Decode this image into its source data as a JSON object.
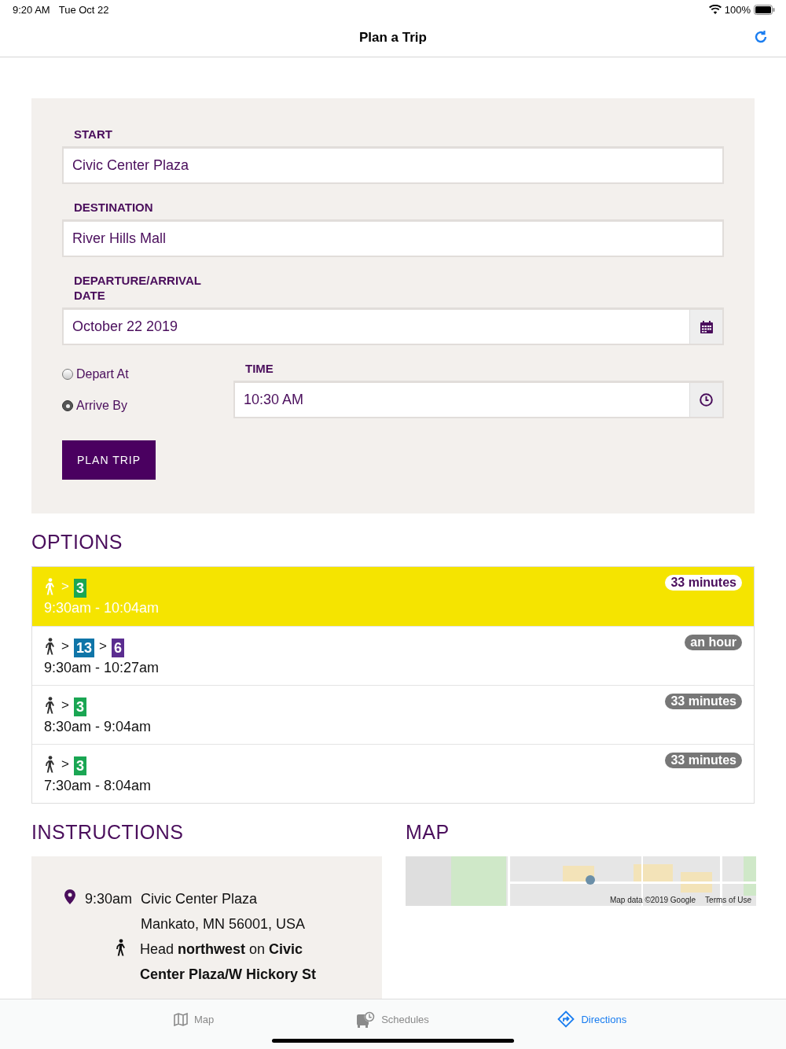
{
  "status_bar": {
    "time": "9:20 AM",
    "date": "Tue Oct 22",
    "battery": "100%"
  },
  "nav": {
    "title": "Plan a Trip"
  },
  "form": {
    "start": {
      "label": "START",
      "value": "Civic Center Plaza"
    },
    "destination": {
      "label": "DESTINATION",
      "value": "River Hills Mall"
    },
    "date": {
      "label": "DEPARTURE/ARRIVAL DATE",
      "value": "October 22 2019"
    },
    "modes": [
      {
        "label": "Depart At",
        "selected": false
      },
      {
        "label": "Arrive By",
        "selected": true
      }
    ],
    "time": {
      "label": "TIME",
      "value": "10:30 AM"
    },
    "button": "PLAN TRIP"
  },
  "options": {
    "title": "OPTIONS",
    "items": [
      {
        "selected": true,
        "legs": [
          {
            "kind": "walk"
          },
          {
            "kind": "sep",
            "text": ">"
          },
          {
            "kind": "route",
            "label": "3",
            "color": "#1aa653"
          }
        ],
        "times": "9:30am - 10:04am",
        "duration": "33 minutes"
      },
      {
        "selected": false,
        "legs": [
          {
            "kind": "walk"
          },
          {
            "kind": "sep",
            "text": ">"
          },
          {
            "kind": "route",
            "label": "13",
            "color": "#0f75a8"
          },
          {
            "kind": "sep",
            "text": ">"
          },
          {
            "kind": "route",
            "label": "6",
            "color": "#5b2d90"
          }
        ],
        "times": "9:30am - 10:27am",
        "duration": "an hour"
      },
      {
        "selected": false,
        "legs": [
          {
            "kind": "walk"
          },
          {
            "kind": "sep",
            "text": ">"
          },
          {
            "kind": "route",
            "label": "3",
            "color": "#1aa653"
          }
        ],
        "times": "8:30am - 9:04am",
        "duration": "33 minutes"
      },
      {
        "selected": false,
        "legs": [
          {
            "kind": "walk"
          },
          {
            "kind": "sep",
            "text": ">"
          },
          {
            "kind": "route",
            "label": "3",
            "color": "#1aa653"
          }
        ],
        "times": "7:30am - 8:04am",
        "duration": "33 minutes"
      }
    ]
  },
  "instructions": {
    "title": "INSTRUCTIONS",
    "steps": [
      {
        "kind": "place",
        "time": "9:30am",
        "lines": [
          "Civic Center Plaza",
          "Mankato, MN 56001, USA"
        ]
      },
      {
        "kind": "walk",
        "text": "Head **northwest** on **Civic Center Plaza/W Hickory St**"
      }
    ]
  },
  "map": {
    "title": "MAP",
    "attribution": "Map data ©2019 Google",
    "terms": "Terms of Use"
  },
  "tabs": [
    {
      "kind": "map",
      "label": "Map",
      "selected": false
    },
    {
      "kind": "schedules",
      "label": "Schedules",
      "selected": false
    },
    {
      "kind": "directions",
      "label": "Directions",
      "selected": true
    }
  ]
}
